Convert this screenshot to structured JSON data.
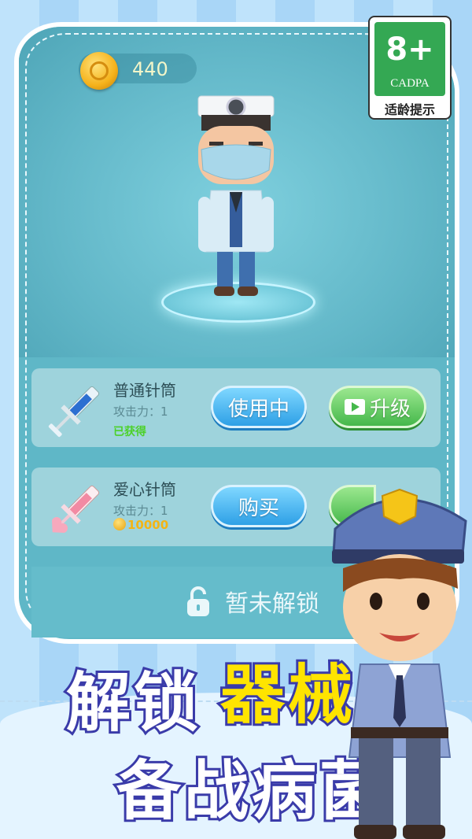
{
  "currency": {
    "coins": "440",
    "icon": "coin-icon"
  },
  "age_rating": {
    "rating": "8+",
    "org": "CADPA",
    "label": "适龄提示"
  },
  "items": [
    {
      "name": "普通针筒",
      "attack": "攻击力：1",
      "status": "已获得",
      "primary_button": "使用中",
      "secondary_button": "升级",
      "icon": "blue-syringe-icon"
    },
    {
      "name": "爱心针筒",
      "attack": "攻击力：1",
      "price": "10000",
      "primary_button": "购买",
      "icon": "pink-heart-syringe-icon"
    }
  ],
  "locked": {
    "label": "暂未解锁",
    "icon": "lock-icon"
  },
  "headline": {
    "line1_white": "解锁",
    "line1_yellow": "器械",
    "line2": "备战病菌"
  },
  "colors": {
    "panel": "#5fb7c7",
    "button_blue": "#2ea0e6",
    "button_green": "#45b84b",
    "headline_yellow": "#ffe400",
    "headline_stroke": "#3a3ba9"
  }
}
